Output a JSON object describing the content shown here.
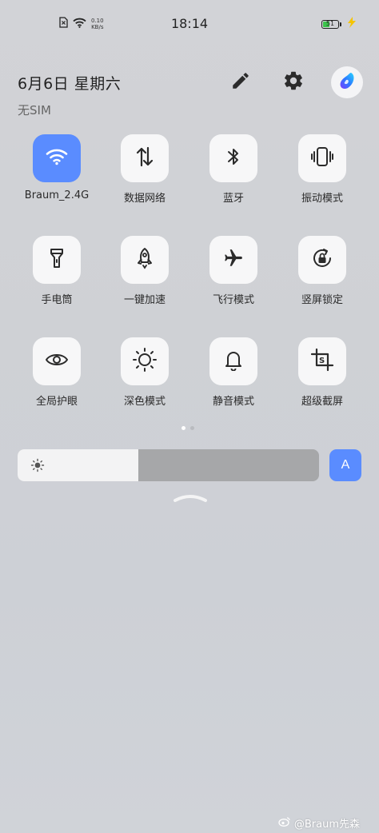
{
  "status_bar": {
    "net_speed_value": "0.10",
    "net_speed_unit": "KB/s",
    "time": "18:14",
    "battery_level": "51",
    "battery_fraction": 0.51,
    "battery_color": "#3bc44b",
    "charging_color": "#f5c400"
  },
  "header": {
    "date": "6月6日 星期六",
    "sim_status": "无SIM"
  },
  "tiles": [
    {
      "label": "Braum_2.4G",
      "icon": "wifi-icon",
      "active": true
    },
    {
      "label": "数据网络",
      "icon": "data-network-icon",
      "active": false
    },
    {
      "label": "蓝牙",
      "icon": "bluetooth-icon",
      "active": false
    },
    {
      "label": "振动模式",
      "icon": "vibrate-icon",
      "active": false
    },
    {
      "label": "手电筒",
      "icon": "flashlight-icon",
      "active": false
    },
    {
      "label": "一键加速",
      "icon": "rocket-icon",
      "active": false
    },
    {
      "label": "飞行模式",
      "icon": "airplane-icon",
      "active": false
    },
    {
      "label": "竖屏锁定",
      "icon": "rotation-lock-icon",
      "active": false
    },
    {
      "label": "全局护眼",
      "icon": "eye-icon",
      "active": false
    },
    {
      "label": "深色模式",
      "icon": "dark-mode-icon",
      "active": false
    },
    {
      "label": "静音模式",
      "icon": "bell-icon",
      "active": false
    },
    {
      "label": "超级截屏",
      "icon": "screenshot-icon",
      "active": false
    }
  ],
  "pager": {
    "pages": 2,
    "current": 1
  },
  "brightness": {
    "level": 0.4,
    "auto_label": "A"
  },
  "accent_color": "#5a8cff",
  "watermark": "@Braum先森"
}
